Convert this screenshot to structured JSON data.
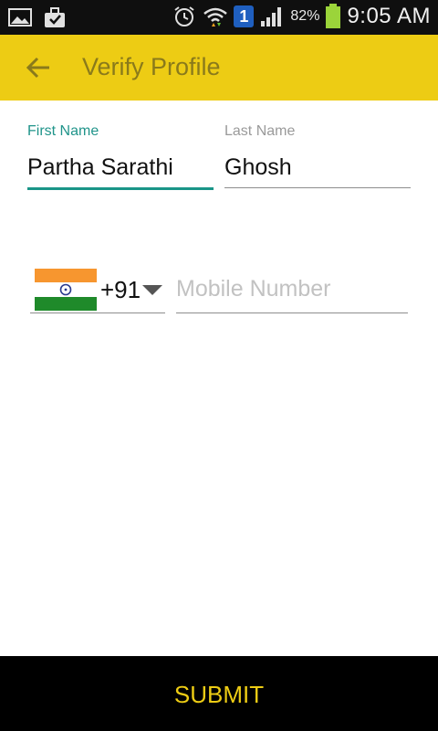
{
  "status_bar": {
    "battery_percent": "82%",
    "time": "9:05 AM",
    "notification_badge": "1",
    "icons": [
      "image-icon",
      "briefcase-icon",
      "alarm-icon",
      "wifi-icon",
      "signal-icon",
      "battery-icon"
    ]
  },
  "app_bar": {
    "title": "Verify Profile",
    "back_icon": "arrow-left-icon"
  },
  "form": {
    "first_name": {
      "label": "First Name",
      "value": "Partha Sarathi"
    },
    "last_name": {
      "label": "Last Name",
      "value": "Ghosh"
    },
    "country_code": "+91",
    "mobile": {
      "placeholder": "Mobile Number",
      "value": ""
    }
  },
  "footer": {
    "submit_label": "SUBMIT"
  },
  "colors": {
    "accent": "#edcc14",
    "focus": "#1a9588"
  }
}
